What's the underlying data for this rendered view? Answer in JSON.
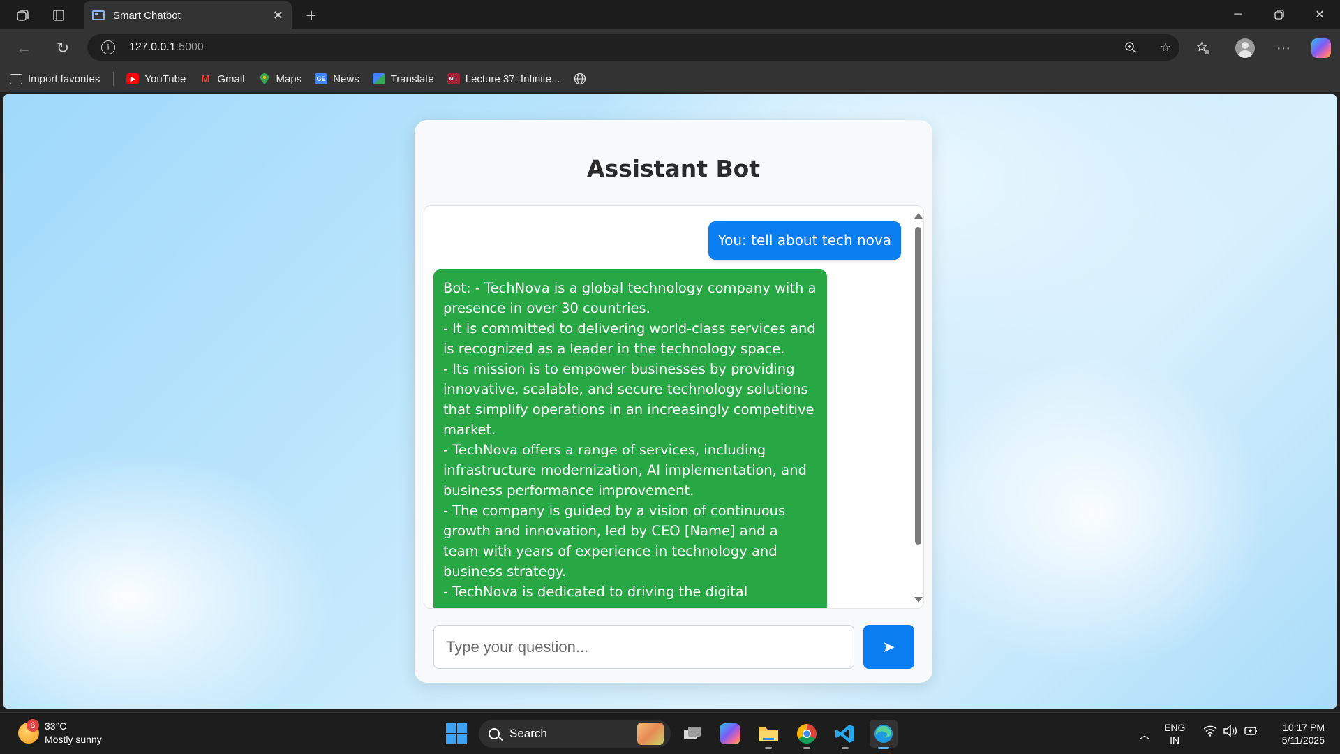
{
  "browser": {
    "tab_title": "Smart Chatbot",
    "url_host": "127.0.0.1",
    "url_port": ":5000",
    "favorites": [
      {
        "label": "Import favorites",
        "icon": "import-icon"
      },
      {
        "label": "YouTube",
        "icon": "youtube-icon",
        "color": "#ff0000"
      },
      {
        "label": "Gmail",
        "icon": "gmail-icon",
        "color": "#ea4335"
      },
      {
        "label": "Maps",
        "icon": "maps-icon",
        "color": "#34a853"
      },
      {
        "label": "News",
        "icon": "news-icon",
        "color": "#4285f4"
      },
      {
        "label": "Translate",
        "icon": "translate-icon",
        "color": "#4285f4"
      },
      {
        "label": "Lecture 37: Infinite...",
        "icon": "mit-ocw-icon",
        "color": "#a31f34"
      }
    ]
  },
  "chat": {
    "title": "Assistant Bot",
    "user_message": "You: tell about tech nova",
    "bot_message": "Bot: - TechNova is a global technology company with a presence in over 30 countries.\n- It is committed to delivering world-class services and is recognized as a leader in the technology space.\n- Its mission is to empower businesses by providing innovative, scalable, and secure technology solutions that simplify operations in an increasingly competitive market.\n- TechNova offers a range of services, including infrastructure modernization, AI implementation, and business performance improvement.\n- The company is guided by a vision of continuous growth and innovation, led by CEO [Name] and a team with years of experience in technology and business strategy.\n- TechNova is dedicated to driving the digital",
    "input_placeholder": "Type your question...",
    "send_label": "➤",
    "user_color": "#0a7df0",
    "bot_color": "#28a745"
  },
  "taskbar": {
    "weather_temp": "33°C",
    "weather_desc": "Mostly sunny",
    "weather_badge": "6",
    "search_label": "Search",
    "lang_top": "ENG",
    "lang_bottom": "IN",
    "time": "10:17 PM",
    "date": "5/11/2025"
  }
}
